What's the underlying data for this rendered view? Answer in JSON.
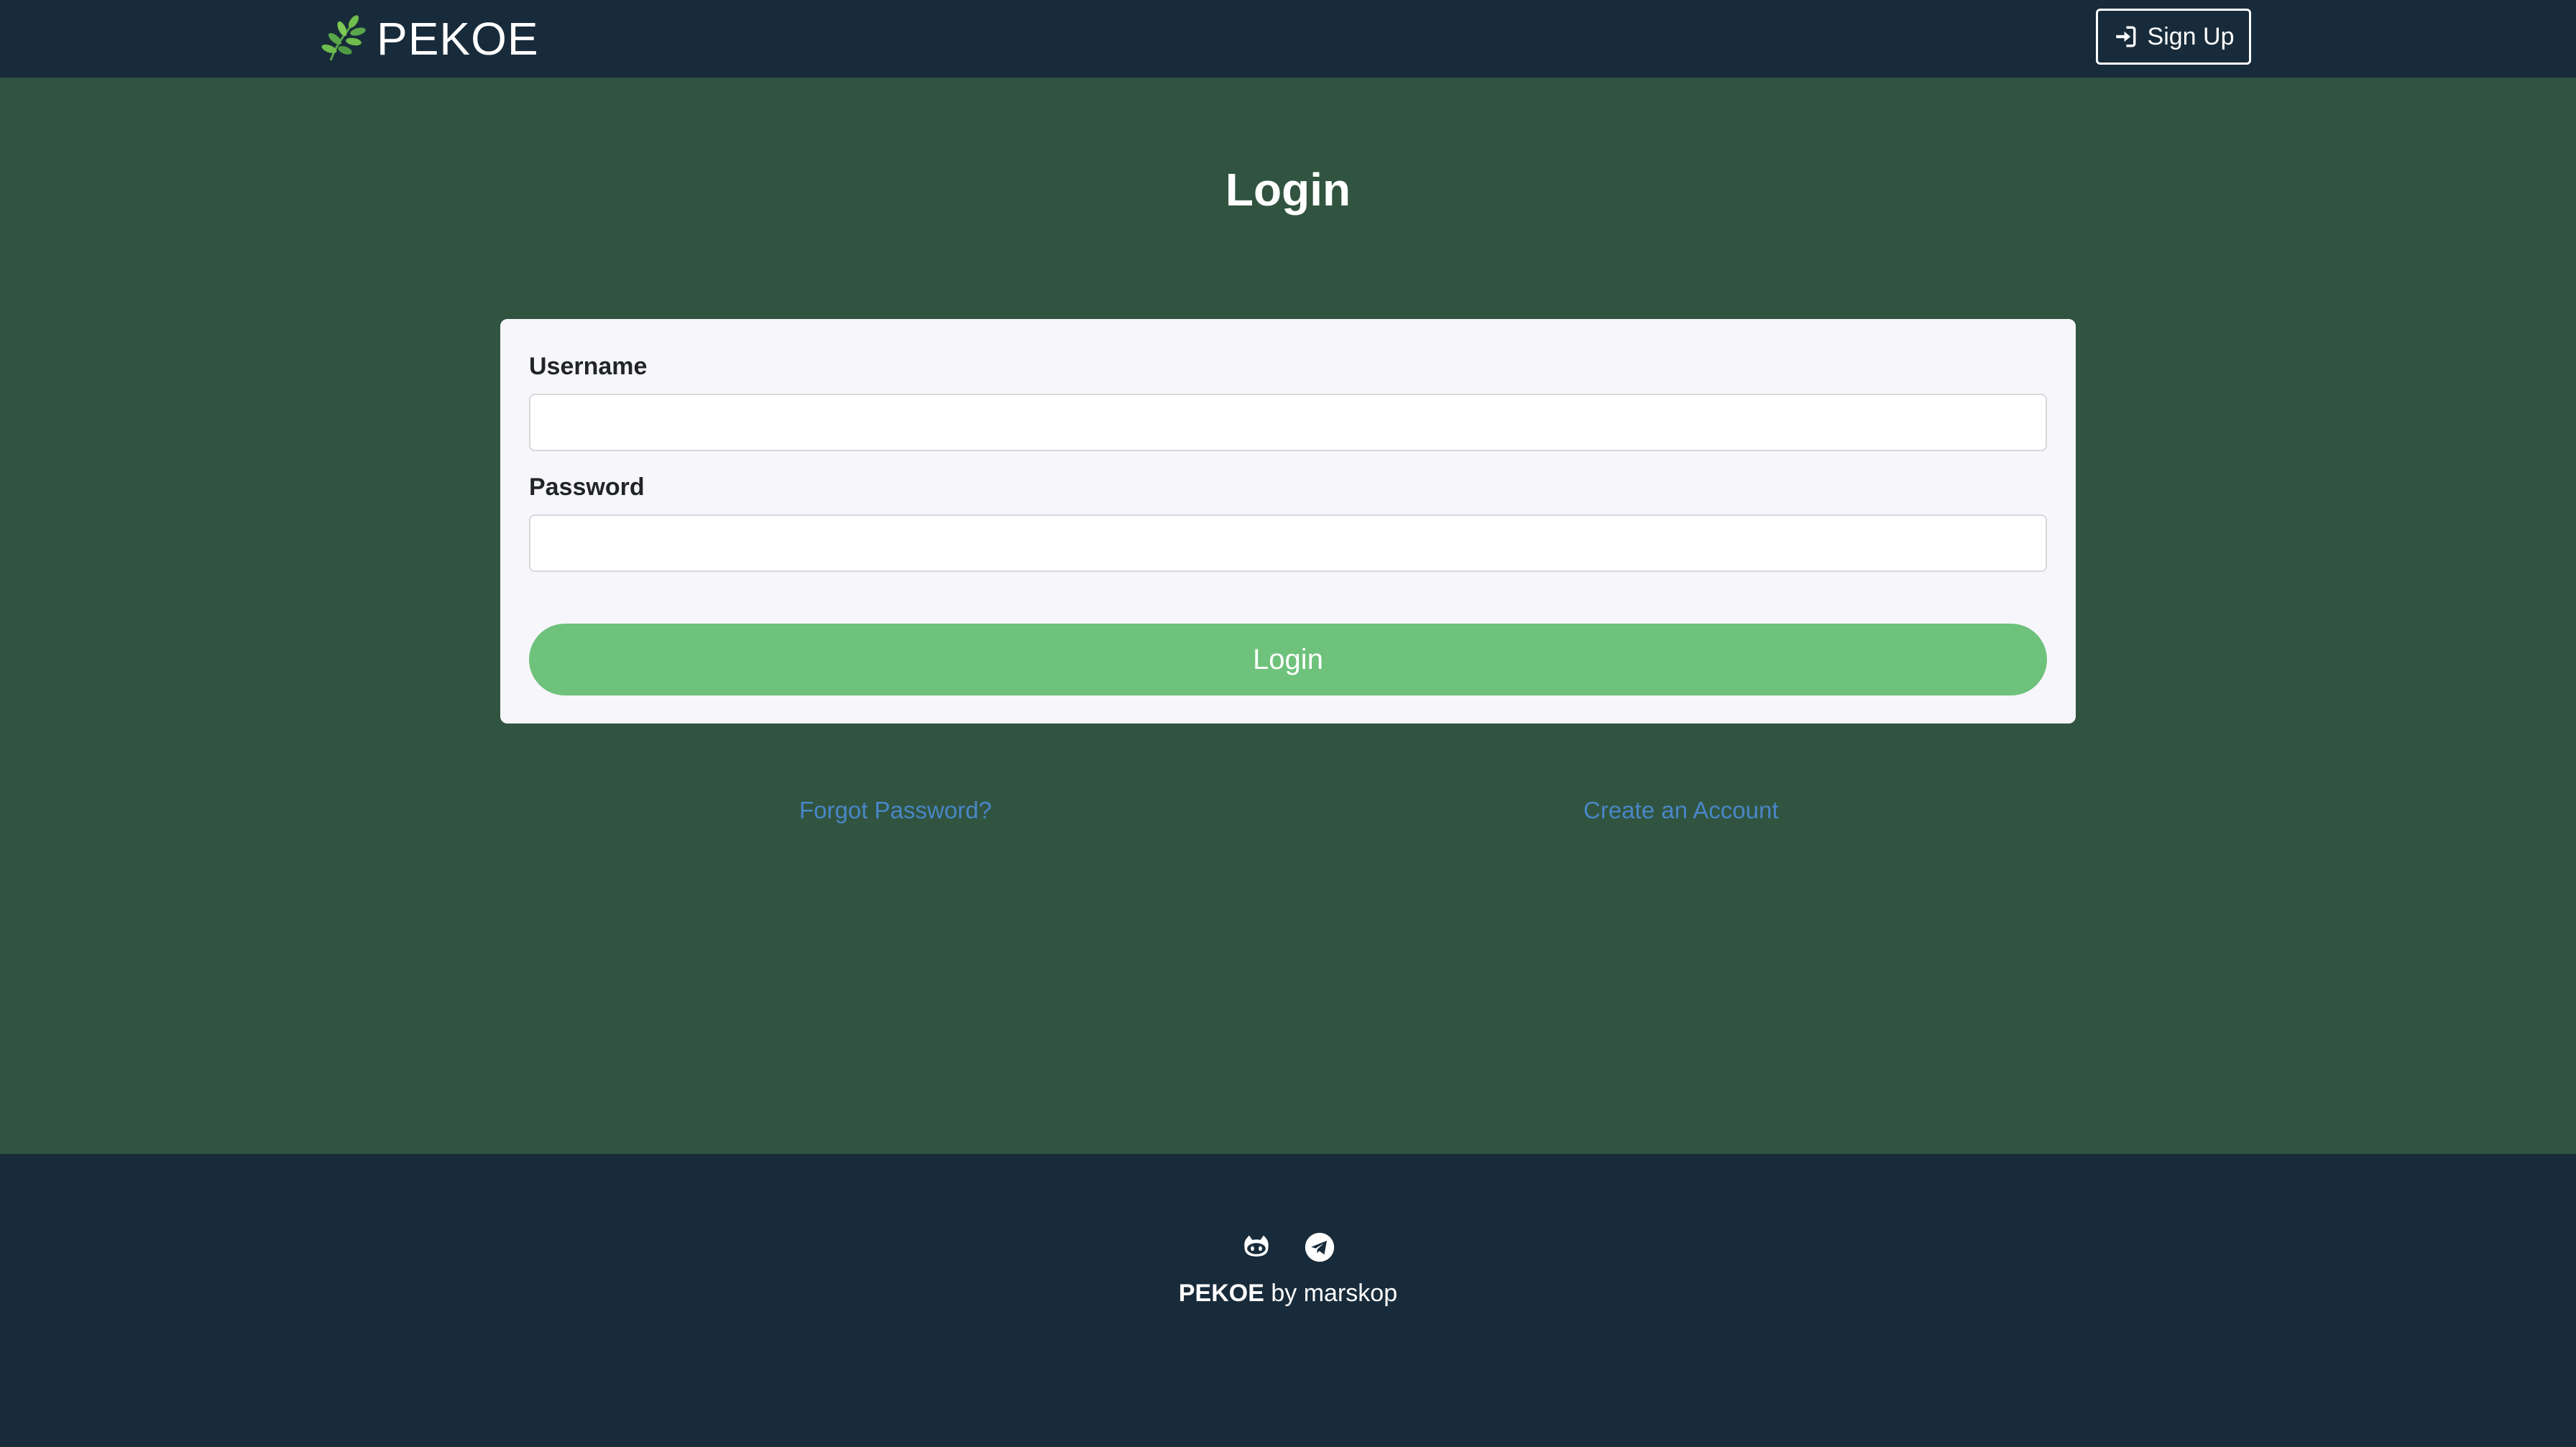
{
  "header": {
    "brand": "PEKOE",
    "brand_icon": "leaf-sprig-icon",
    "signup_label": "Sign Up",
    "signup_icon": "sign-in-arrow-icon"
  },
  "main": {
    "title": "Login",
    "form": {
      "username_label": "Username",
      "username_value": "",
      "password_label": "Password",
      "password_value": "",
      "submit_label": "Login"
    },
    "links": {
      "forgot": "Forgot Password?",
      "create": "Create an Account"
    }
  },
  "footer": {
    "icons": [
      "github-icon",
      "telegram-icon"
    ],
    "brand": "PEKOE",
    "by_text": "by marskop"
  },
  "colors": {
    "navbar_bg": "#182b3a",
    "page_bg": "#30543f",
    "card_bg": "#f7f6fb",
    "accent_green": "#6ec27b",
    "link_blue": "#4a86c7"
  }
}
